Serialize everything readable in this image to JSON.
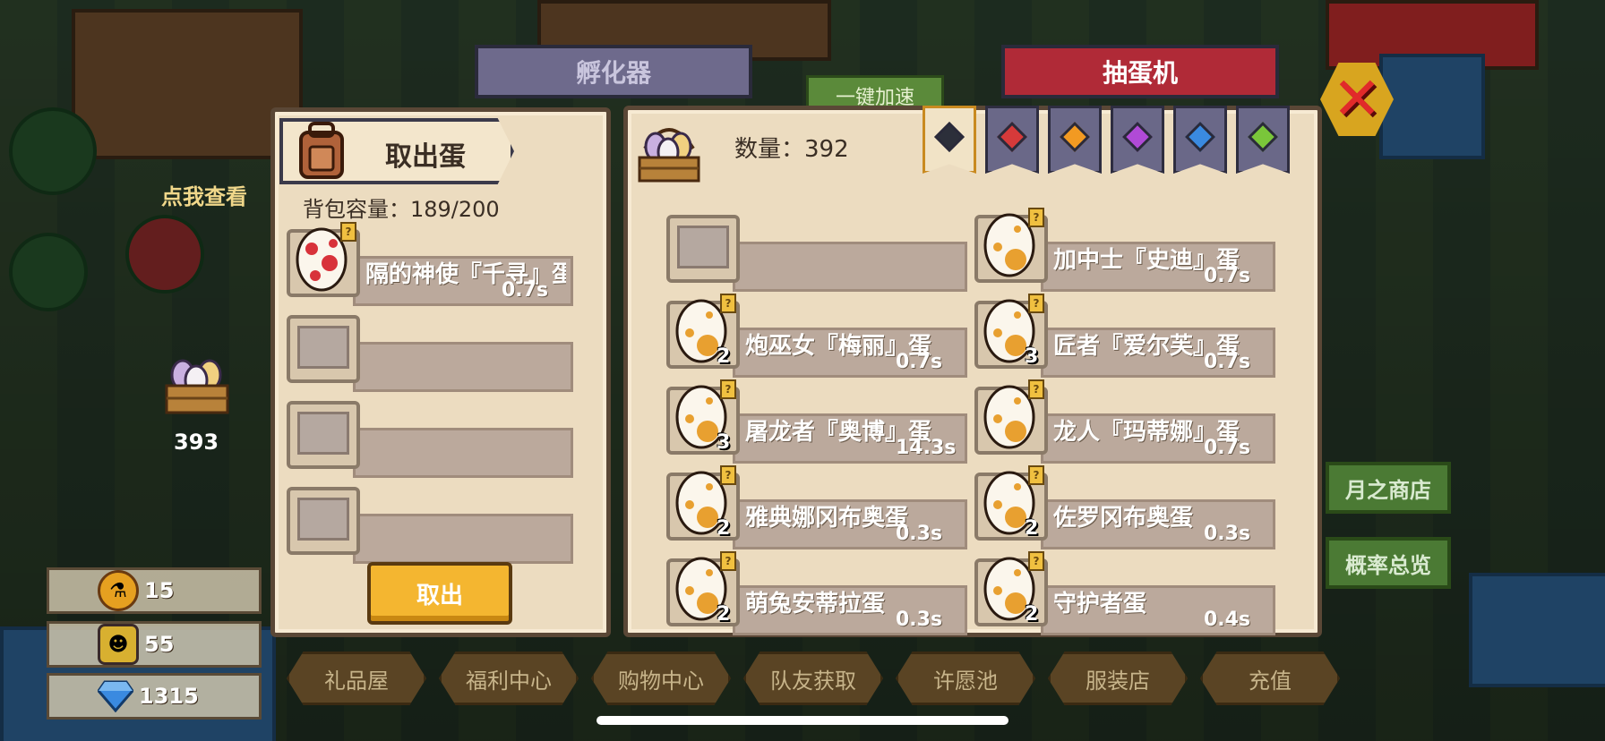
{
  "background": {
    "incubator_tab": "孵化器",
    "gacha_tab": "抽蛋机",
    "quick_accelerate": "一键加速",
    "click_to_view": "点我查看",
    "basket_count": "393"
  },
  "currencies": [
    {
      "icon": "potion-icon",
      "value": "15"
    },
    {
      "icon": "character-token-icon",
      "value": "55"
    },
    {
      "icon": "diamond-icon",
      "value": "1315"
    }
  ],
  "bottom_nav": [
    "礼品屋",
    "福利中心",
    "购物中心",
    "队友获取",
    "许愿池",
    "服装店",
    "充值"
  ],
  "right_buttons": [
    "月之商店",
    "概率总览"
  ],
  "take_out_panel": {
    "title": "取出蛋",
    "capacity_label": "背包容量：",
    "capacity_value": "189/200",
    "slots": [
      {
        "name": "隔的神使『千寻』蛋",
        "time": "0.7s",
        "egg": "red"
      },
      {
        "name": "",
        "time": "",
        "egg": ""
      },
      {
        "name": "",
        "time": "",
        "egg": ""
      },
      {
        "name": "",
        "time": "",
        "egg": ""
      }
    ],
    "take_out_button": "取出"
  },
  "egg_list_panel": {
    "quantity_label": "数量：",
    "quantity_value": "392",
    "filter_tabs": [
      {
        "color": "#2c2f3a",
        "active": true
      },
      {
        "color": "#d63a3a",
        "active": false
      },
      {
        "color": "#f29a22",
        "active": false
      },
      {
        "color": "#b04ad6",
        "active": false
      },
      {
        "color": "#3a8ae0",
        "active": false
      },
      {
        "color": "#7ac63a",
        "active": false
      }
    ],
    "items": [
      {
        "name": "",
        "time": "",
        "count": "",
        "egg": ""
      },
      {
        "name": "加中士『史迪』蛋",
        "time": "0.7s",
        "count": "",
        "egg": "orange"
      },
      {
        "name": "炮巫女『梅丽』蛋",
        "time": "0.7s",
        "count": "2",
        "egg": "orange"
      },
      {
        "name": "匠者『爱尔芙』蛋",
        "time": "0.7s",
        "count": "3",
        "egg": "orange"
      },
      {
        "name": "屠龙者『奥博』蛋",
        "time": "14.3s",
        "count": "3",
        "egg": "orange"
      },
      {
        "name": "龙人『玛蒂娜』蛋",
        "time": "0.7s",
        "count": "",
        "egg": "orange"
      },
      {
        "name": "雅典娜冈布奥蛋",
        "time": "0.3s",
        "count": "2",
        "egg": "orange"
      },
      {
        "name": "佐罗冈布奥蛋",
        "time": "0.3s",
        "count": "2",
        "egg": "orange"
      },
      {
        "name": "萌兔安蒂拉蛋",
        "time": "0.3s",
        "count": "2",
        "egg": "orange"
      },
      {
        "name": "守护者蛋",
        "time": "0.4s",
        "count": "2",
        "egg": "orange"
      }
    ]
  },
  "colors": {
    "panel_bg": "#ecdcc0",
    "panel_border": "#5a4736",
    "accent_button": "#f4b630",
    "close": "#e12a2a",
    "egg_red": "#d8323a",
    "egg_orange": "#e8a030"
  }
}
